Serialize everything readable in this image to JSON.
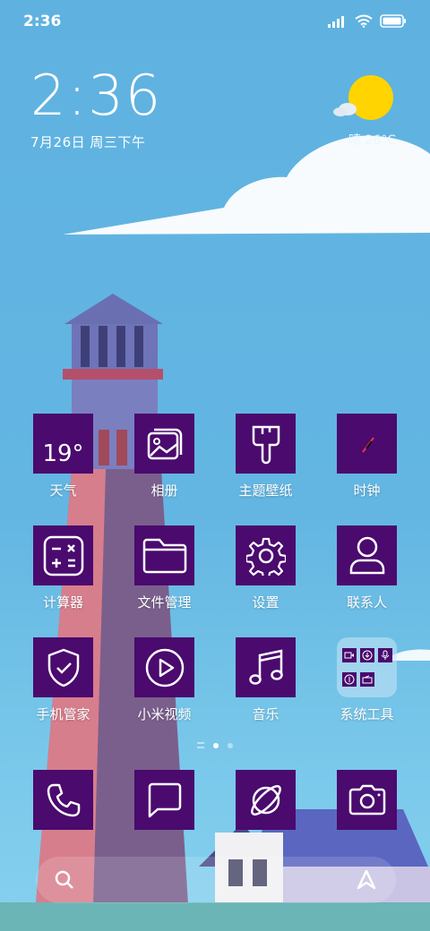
{
  "status_bar": {
    "time": "2:36"
  },
  "clock_widget": {
    "time": "2:36",
    "date": "7月26日 周三下午"
  },
  "weather_widget": {
    "text": "晴 26°C"
  },
  "apps": [
    {
      "name": "weather",
      "label": "天气",
      "tile_text": "19°",
      "icon": "weather-icon"
    },
    {
      "name": "gallery",
      "label": "相册",
      "icon": "gallery-icon"
    },
    {
      "name": "themes",
      "label": "主题壁纸",
      "icon": "paintbrush-icon"
    },
    {
      "name": "clock",
      "label": "时钟",
      "icon": "clock-icon"
    },
    {
      "name": "calculator",
      "label": "计算器",
      "icon": "calculator-icon"
    },
    {
      "name": "file-manager",
      "label": "文件管理",
      "icon": "folder-icon"
    },
    {
      "name": "settings",
      "label": "设置",
      "icon": "gear-icon"
    },
    {
      "name": "contacts",
      "label": "联系人",
      "icon": "person-icon"
    },
    {
      "name": "security",
      "label": "手机管家",
      "icon": "shield-check-icon"
    },
    {
      "name": "mi-video",
      "label": "小米视频",
      "icon": "play-icon"
    },
    {
      "name": "music",
      "label": "音乐",
      "icon": "music-note-icon"
    },
    {
      "name": "system-tools",
      "label": "系统工具",
      "icon": "folder-icon"
    }
  ],
  "dock": [
    {
      "name": "phone",
      "icon": "phone-icon"
    },
    {
      "name": "messages",
      "icon": "message-icon"
    },
    {
      "name": "browser",
      "icon": "planet-icon"
    },
    {
      "name": "camera",
      "icon": "camera-icon"
    }
  ],
  "page_indicator": {
    "pages": 2,
    "current": 1
  },
  "colors": {
    "tile": "#4a0a6e",
    "sky": "#63b6e2"
  }
}
